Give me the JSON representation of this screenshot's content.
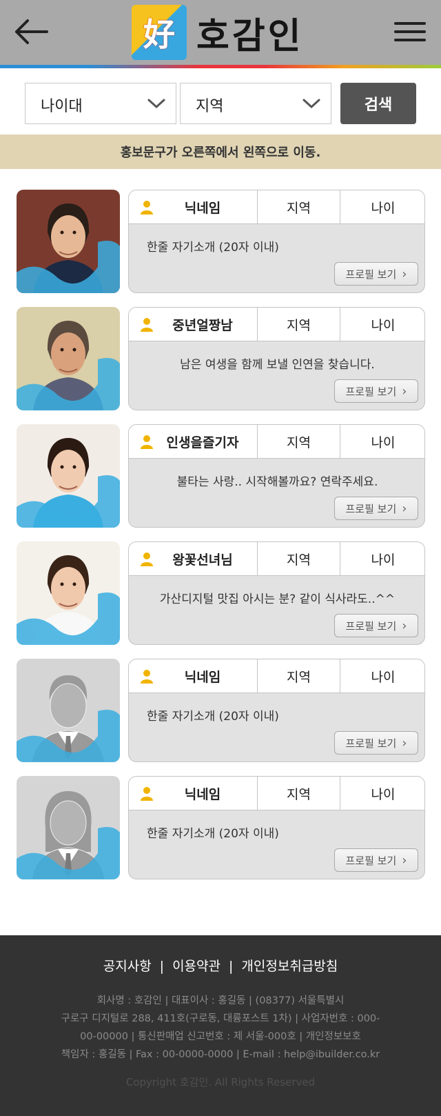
{
  "header": {
    "back_icon": "arrow-left-icon",
    "logo_glyph": "好",
    "logo_text": "호감인",
    "menu_icon": "hamburger-menu-icon"
  },
  "search": {
    "age_select": "나이대",
    "region_select": "지역",
    "button_label": "검색"
  },
  "promo": "홍보문구가 오른쪽에서 왼쪽으로 이동.",
  "colors": {
    "header_bg": "#a9a9a9",
    "accent_blue": "#3aaee0",
    "promo_bg": "#e0d4b3",
    "footer_bg": "#333333",
    "user_icon": "#f0b400"
  },
  "profiles": [
    {
      "name": "닉네임",
      "region": "지역",
      "age": "나이",
      "intro": "한줄 자기소개 (20자 이내)",
      "button": "프로필 보기"
    },
    {
      "name": "중년얼짱남",
      "region": "지역",
      "age": "나이",
      "intro": "남은 여생을 함께 보낼 인연을 찾습니다.",
      "button": "프로필 보기"
    },
    {
      "name": "인생을즐기자",
      "region": "지역",
      "age": "나이",
      "intro": "불타는 사랑.. 시작해볼까요? 연락주세요.",
      "button": "프로필 보기"
    },
    {
      "name": "왕꽃선녀님",
      "region": "지역",
      "age": "나이",
      "intro": "가산디지털 맛집 아시는 분? 같이 식사라도..^^",
      "button": "프로필 보기"
    },
    {
      "name": "닉네임",
      "region": "지역",
      "age": "나이",
      "intro": "한줄 자기소개 (20자 이내)",
      "button": "프로필 보기"
    },
    {
      "name": "닉네임",
      "region": "지역",
      "age": "나이",
      "intro": "한줄 자기소개 (20자 이내)",
      "button": "프로필 보기"
    }
  ],
  "footer": {
    "links": [
      "공지사항",
      "이용약관",
      "개인정보취급방침"
    ],
    "info_line1": "회사명 : 호감인 | 대표이사 : 홍길동 | (08377) 서울특별시",
    "info_line2": "구로구 디지털로 288, 411호(구로동, 대륭포스트 1차) | 사업자번호 : 000-",
    "info_line3": "00-00000 | 통신판매업 신고번호 : 제 서울-000호 | 개인정보보호",
    "info_line4": "책임자 : 홍길동 | Fax : 00-0000-0000 | E-mail : help@ibuilder.co.kr",
    "copyright": "Copyright 호감인. All Rights Reserved"
  }
}
